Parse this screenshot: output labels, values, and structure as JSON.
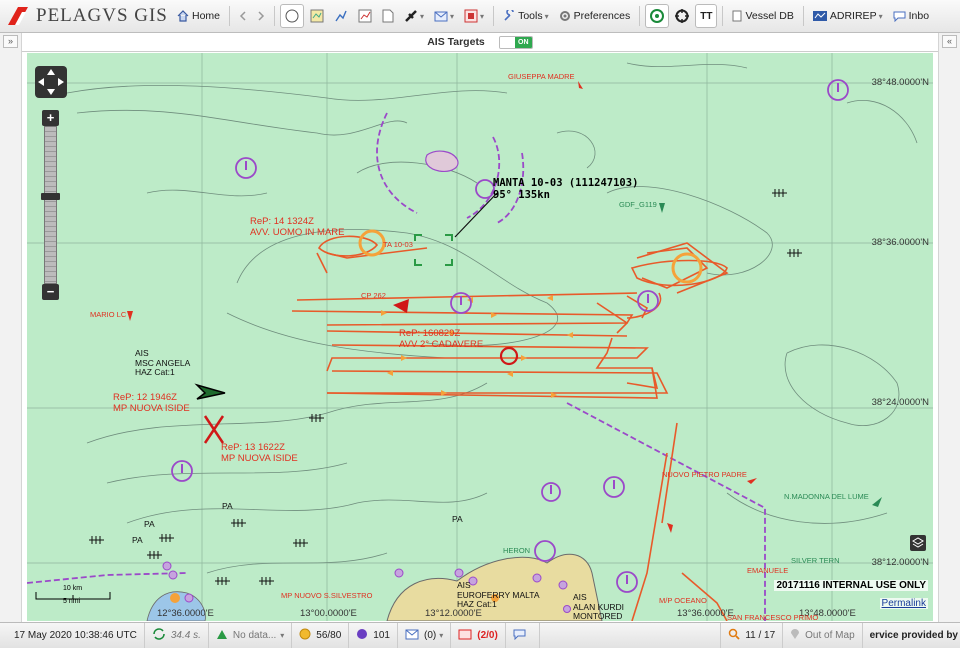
{
  "app": {
    "name": "PELAGVS GIS"
  },
  "toolbar": {
    "home_label": "Home",
    "tools_label": "Tools",
    "preferences_label": "Preferences",
    "tt_label": "TT",
    "vessel_db_label": "Vessel DB",
    "adrirep_label": "ADRIREP",
    "inbox_label": "Inbo"
  },
  "ais_targets": {
    "label": "AIS Targets",
    "toggle_state": "ON"
  },
  "map": {
    "lat_labels": [
      "38°48.0000'N",
      "38°36.0000'N",
      "38°24.0000'N",
      "38°12.0000'N"
    ],
    "lon_labels": [
      "12°36.0000'E",
      "13°00.0000'E",
      "13°12.0000'E",
      "13°36.0000'E",
      "13°48.0000'E"
    ],
    "target": {
      "line1": "MANTA 10-03 (111247103)",
      "line2": "95° 135kn"
    },
    "reports": [
      {
        "line1": "ReP: 14 1324Z",
        "line2": "AVV. UOMO IN MARE"
      },
      {
        "line1": "ReP: 160829Z",
        "line2": "AVV 2° CADAVERE"
      },
      {
        "line1": "ReP: 12 1946Z",
        "line2": "MP NUOVA ISIDE"
      },
      {
        "line1": "ReP: 13 1622Z",
        "line2": "MP NUOVA ISIDE"
      }
    ],
    "ais_angela": {
      "line1": "AIS",
      "line2": "MSC ANGELA",
      "line3": "HAZ Cat:1"
    },
    "ais_euroferry": {
      "line1": "AIS",
      "line2": "EUROFERRY MALTA",
      "line3": "HAZ Cat:1"
    },
    "ais_alan": {
      "line1": "AIS",
      "line2": "ALAN KURDI",
      "line3": "MONTORED"
    },
    "vessels": {
      "giuseppa": "GIUSEPPA MADRE",
      "mario": "MARIO LC",
      "gdf": "GDF_G119",
      "nuovo_pietro": "NUOVO PIETRO PADRE",
      "madonna": "N.MADONNA DEL LUME",
      "silver_tern": "SILVER TERN",
      "emanuele": "EMANUELE",
      "mp_nuovo_silvestro": "MP NUOVO S.SILVESTRO",
      "mp_oceano": "M/P OCEANO",
      "francesco": "SAN FRANCESCO PRIMO",
      "gp262": "CP 262",
      "ta": "TA 10-03",
      "heron": "HERON"
    },
    "pa_labels": [
      "PA",
      "PA",
      "PA",
      "PA"
    ],
    "internal_notice": "20171116 INTERNAL USE ONLY",
    "permalink": "Permalink",
    "scale": {
      "top": "10 km",
      "bottom": "5 nmi"
    }
  },
  "statusbar": {
    "datetime": "17 May 2020 10:38:46 UTC",
    "refresh": "34.4 s.",
    "data_status": "No data...",
    "counter": "56/80",
    "count2": "101",
    "messages": "(0)",
    "alerts": "(2/0)",
    "pagination": "11 / 17",
    "out_of_map": "Out of Map",
    "service": "ervice provided by"
  },
  "colors": {
    "sea": "#bdebc8",
    "land": "#e8dca0",
    "track": "#e85a2a",
    "alert": "#e03020",
    "warn": "#9b49c9"
  }
}
